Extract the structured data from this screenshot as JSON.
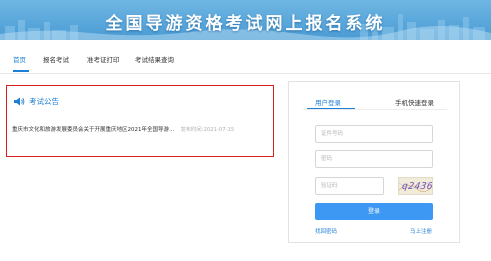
{
  "banner": {
    "title": "全国导游资格考试网上报名系统"
  },
  "nav": {
    "items": [
      {
        "label": "首页",
        "active": true
      },
      {
        "label": "报名考试",
        "active": false
      },
      {
        "label": "准考证打印",
        "active": false
      },
      {
        "label": "考试结果查询",
        "active": false
      }
    ]
  },
  "notice": {
    "icon": "speaker-icon",
    "title": "考试公告",
    "items": [
      {
        "text": "重庆市文化和旅游发展委员会关于开展重庆地区2021年全国导游…",
        "date_label": "发布时间:2021-07-15"
      }
    ]
  },
  "login": {
    "tabs": [
      {
        "label": "用户登录",
        "active": true
      },
      {
        "label": "手机快速登录",
        "active": false
      }
    ],
    "account_placeholder": "证件号码",
    "password_placeholder": "密码",
    "code_placeholder": "验证码",
    "captcha_text": "q2436",
    "submit_label": "登录",
    "forgot_label": "找回密码",
    "register_label": "马上注册"
  },
  "colors": {
    "accent": "#1e7fd6",
    "button": "#3d98f3",
    "highlight_border": "#d9201e",
    "banner": "#58a6da"
  }
}
